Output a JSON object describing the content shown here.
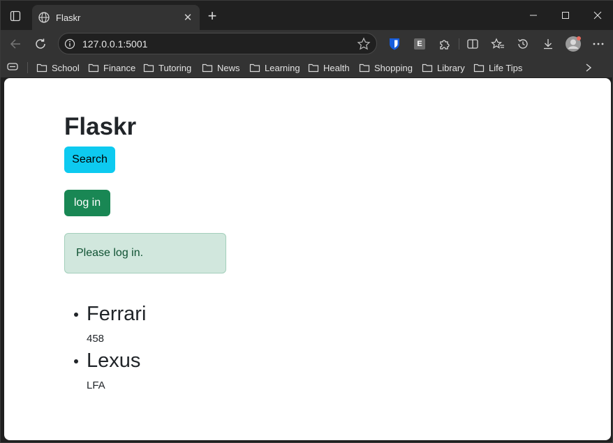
{
  "browser": {
    "tab": {
      "title": "Flaskr"
    },
    "address": {
      "url": "127.0.0.1:5001"
    },
    "bookmarks": [
      "School",
      "Finance",
      "Tutoring",
      "News",
      "Learning",
      "Health",
      "Shopping",
      "Library",
      "Life Tips"
    ],
    "extension_letter": "E"
  },
  "page": {
    "title": "Flaskr",
    "search_label": "Search",
    "login_label": "log in",
    "alert": "Please log in.",
    "posts": [
      {
        "name": "Ferrari",
        "model": "458"
      },
      {
        "name": "Lexus",
        "model": "LFA"
      }
    ]
  },
  "colors": {
    "search_button": "#0dcaf0",
    "login_button": "#198754",
    "alert_bg": "#d1e7dd"
  }
}
